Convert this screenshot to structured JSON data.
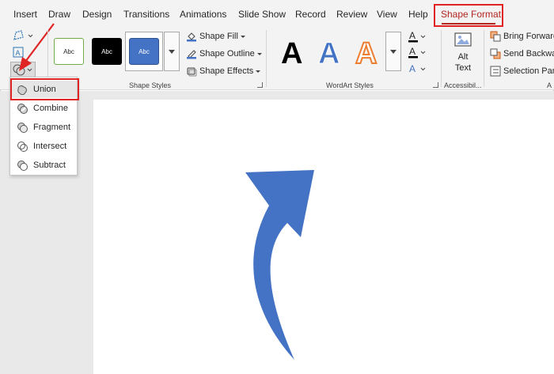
{
  "tabs": {
    "insert": "Insert",
    "draw": "Draw",
    "design": "Design",
    "transitions": "Transitions",
    "animations": "Animations",
    "slideshow": "Slide Show",
    "record": "Record",
    "review": "Review",
    "view": "View",
    "help": "Help",
    "shape_format": "Shape Format"
  },
  "shape_styles": {
    "thumb_label": "Abc",
    "shape_fill": "Shape Fill",
    "shape_outline": "Shape Outline",
    "shape_effects": "Shape Effects",
    "group_label": "Shape Styles",
    "colors": {
      "accent_blue": "#4472c4",
      "outline_green": "#70ad47",
      "black": "#000000"
    }
  },
  "wordart": {
    "letter": "A",
    "group_label": "WordArt Styles",
    "colors": {
      "black": "#000000",
      "blue": "#4472c4",
      "orange": "#ed7d31"
    }
  },
  "accessibility": {
    "alt_text_line1": "Alt",
    "alt_text_line2": "Text",
    "group_label": "Accessibil..."
  },
  "arrange": {
    "bring_forward": "Bring Forward",
    "send_backward": "Send Backward",
    "selection_pane": "Selection Pane",
    "group_label": "A"
  },
  "merge_menu": {
    "items": [
      "Union",
      "Combine",
      "Fragment",
      "Intersect",
      "Subtract"
    ]
  },
  "slide": {
    "shape": "curved-up-arrow",
    "shape_color": "#4472c4"
  },
  "annotation": {
    "highlight_color": "#e02424"
  }
}
